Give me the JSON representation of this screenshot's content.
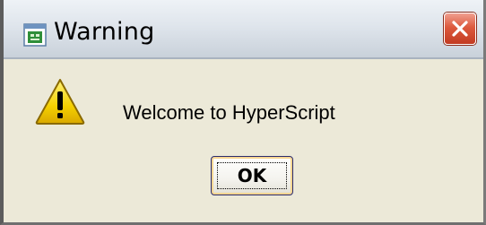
{
  "window": {
    "title": "Warning",
    "app_icon": "hyperscript-app-icon",
    "close_icon": "close-icon"
  },
  "dialog": {
    "icon": "warning-icon",
    "message": "Welcome to HyperScript",
    "ok_label": "OK"
  },
  "colors": {
    "dialog_background": "#ece9d8",
    "close_button": "#dd5a3e",
    "warning_yellow": "#f5d000"
  }
}
